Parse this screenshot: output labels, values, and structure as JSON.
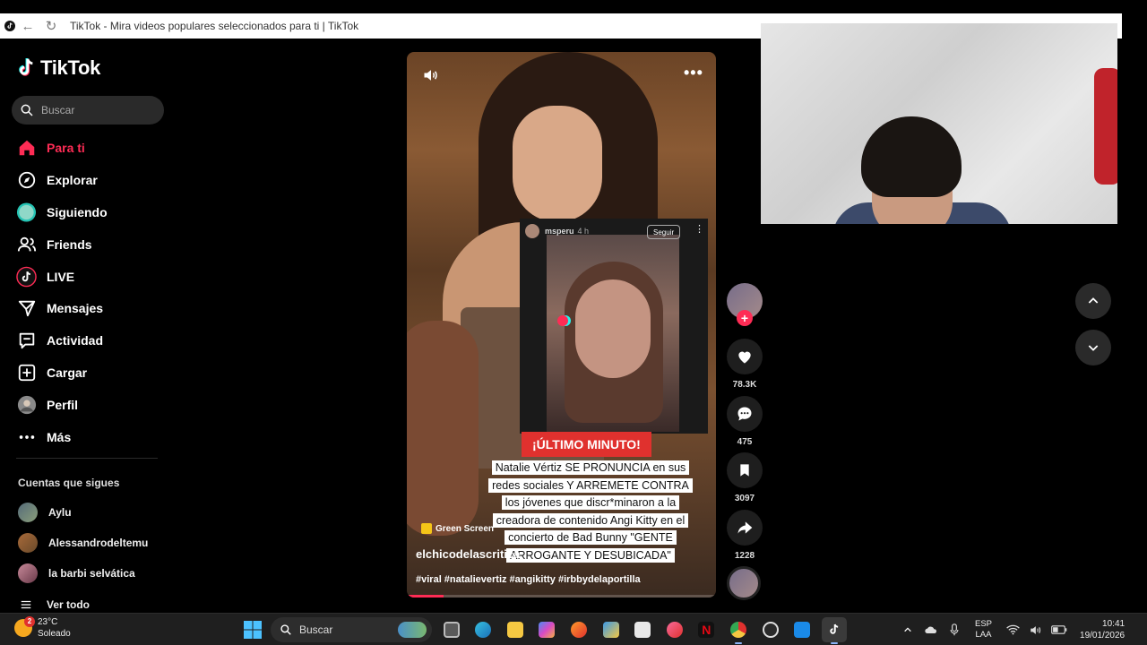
{
  "browser": {
    "tab_title": "TikTok - Mira videos populares seleccionados para ti | TikTok"
  },
  "sidebar": {
    "logo_text": "TikTok",
    "search_placeholder": "Buscar",
    "nav": [
      {
        "label": "Para ti",
        "icon": "home-icon",
        "active": true
      },
      {
        "label": "Explorar",
        "icon": "compass-icon"
      },
      {
        "label": "Siguiendo",
        "icon": "following-avatar-icon"
      },
      {
        "label": "Friends",
        "icon": "friends-icon"
      },
      {
        "label": "LIVE",
        "icon": "live-icon"
      },
      {
        "label": "Mensajes",
        "icon": "send-icon"
      },
      {
        "label": "Actividad",
        "icon": "activity-icon"
      },
      {
        "label": "Cargar",
        "icon": "upload-icon"
      },
      {
        "label": "Perfil",
        "icon": "profile-avatar-icon"
      },
      {
        "label": "Más",
        "icon": "more-dots-icon"
      }
    ],
    "follows_title": "Cuentas que sigues",
    "follows": [
      {
        "name": "Aylu"
      },
      {
        "name": "Alessandrodeltemu"
      },
      {
        "name": "la barbi selvática"
      }
    ],
    "see_all": "Ver todo"
  },
  "video": {
    "inset": {
      "username": "msperu",
      "time": "4 h",
      "follow_label": "Seguir"
    },
    "breaking_label": "¡ÚLTIMO MINUTO!",
    "caption": "Natalie Vértiz SE PRONUNCIA en sus redes sociales Y ARREMETE CONTRA los jóvenes que discr*minaron a la creadora de contenido Angi Kitty en el concierto de Bad Bunny \"GENTE ARROGANTE Y DESUBICADA\"",
    "effect_label": "Green Screen",
    "author": "elchicodelascritica",
    "hashtags": "#viral #natalievertiz #angikitty #irbbydelaportilla",
    "progress_percent": 12
  },
  "actions": {
    "likes": "78.3K",
    "comments": "475",
    "saves": "3097",
    "shares": "1228"
  },
  "taskbar": {
    "temperature": "23°C",
    "weather": "Soleado",
    "weather_badge": "2",
    "search_label": "Buscar",
    "language": "ESP",
    "region": "LAA",
    "time": "10:41",
    "date": "19/01/2026"
  },
  "colors": {
    "accent": "#fe2c55",
    "background": "#000000",
    "breaking_bg": "#e0312e"
  }
}
